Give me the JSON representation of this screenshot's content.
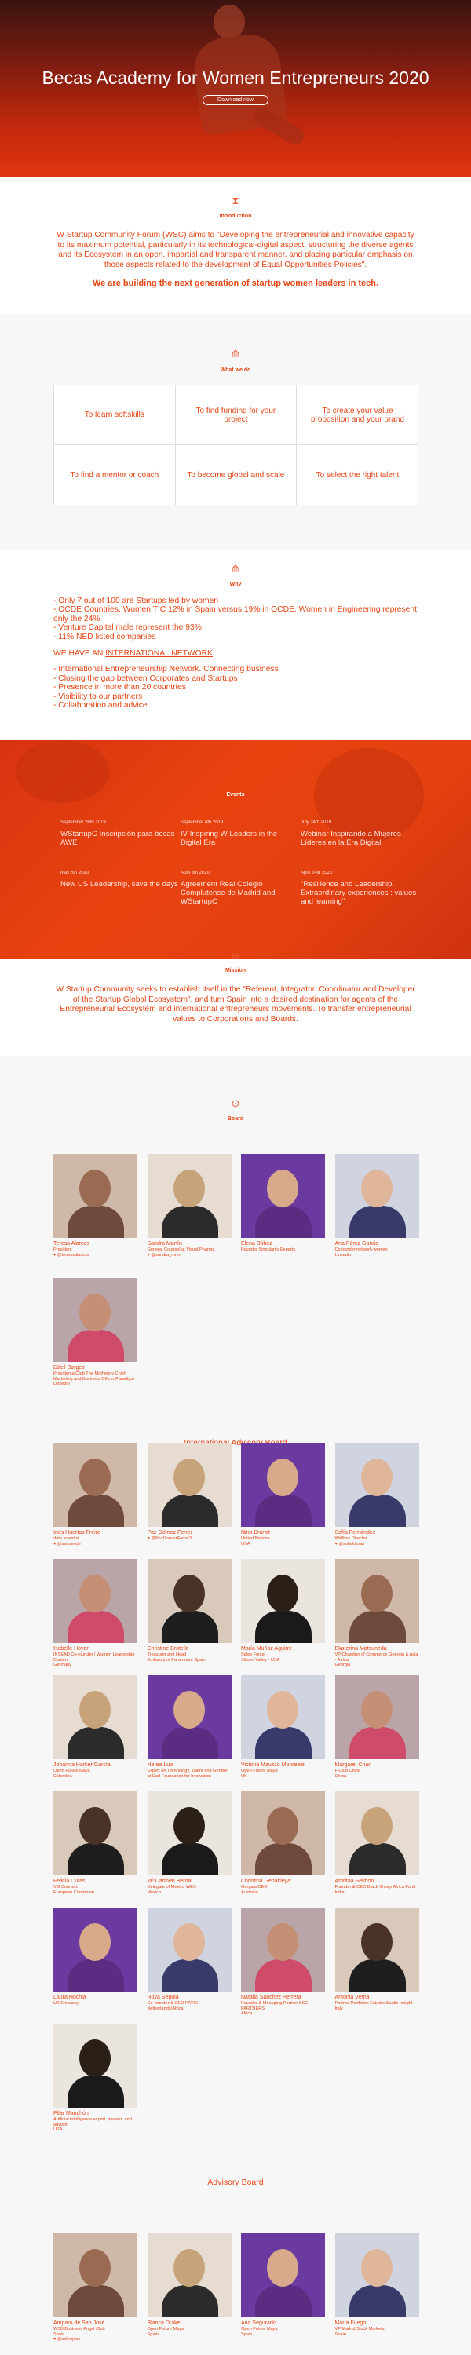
{
  "hero": {
    "title": "Becas Academy for Women Entrepreneurs 2020",
    "button": "Download now"
  },
  "intro": {
    "title": "Introduction",
    "text": "W Startup Community Forum (WSC) aims to \"Developing the entrepreneurial and innovative capacity to its maximum potential, particularly in its technological-digital aspect, structuring the diverse agents and its Ecosystem in an open, impartial and transparent manner, and placing particular emphasis on those aspects related to the development of Equal Opportunities Policies\".",
    "bold": "We are building the next generation of startup women leaders in tech."
  },
  "whatwedo": {
    "title": "What we do",
    "items": [
      "To learn softskills",
      "To find funding for your project",
      "To create your value proposition and your brand",
      "To find a mentor or coach",
      "To become global and scale",
      "To select the right talent"
    ]
  },
  "why": {
    "title": "Why",
    "lines": [
      "- Only 7 out of 100 are Startups led by women",
      "- OCDE Countries. Women TIC 12% in Spain versus 19% in OCDE. Women in Engineering represent only the 24%",
      "- Venture Capital male represent the 93%",
      "- 11% NED listed companies"
    ],
    "network_prefix": "WE HAVE AN ",
    "network_link": "INTERNATIONAL NETWORK",
    "network_lines": [
      "- International Entrepreneurship Network. Connecting business",
      "- Closing the gap between Corporates and Startups",
      "- Presence in more than 20 countries",
      "- Visibility to our partners",
      "- Collaboration and advice"
    ]
  },
  "events": {
    "title": "Events",
    "items": [
      {
        "date": "September 26th 2019",
        "title": "WStartupC Inscripción para becas AWE"
      },
      {
        "date": "September 4th 2019",
        "title": "IV Inspiring W Leaders in the Digital Era"
      },
      {
        "date": "July 24th 2019",
        "title": "Webinar Inspirando a Mujeres Líderes en la Era Digital"
      },
      {
        "date": "May 6th 2020",
        "title": "New US Leadership, save the days"
      },
      {
        "date": "April 8th 2020",
        "title": "Agreement Real Colegio Complutense de Madrid and WStartupC"
      },
      {
        "date": "April 24th 2020",
        "title": "\"Resilience and Leadership. Extraordinary experiences : values and learning\""
      }
    ]
  },
  "mission": {
    "title": "Mission",
    "text": "W Startup Community seeks to establish itself in the \"Referent, Integrator, Coordinator and Developer of the Startup Global Ecosystem\", and turn Spain into a desired destination for agents of the Entrepreneurial Ecosystem and international entrepreneurs movements. To transfer entrepreneurial values to Corporations and Boards."
  },
  "board": {
    "title": "Board",
    "members": [
      {
        "name": "Teresa Alarcos",
        "role": "President\n♥ @tenessalarcos"
      },
      {
        "name": "Sandra Martín",
        "role": "General Counsel at Visual Pharma\n♥ @sandra_mrtn"
      },
      {
        "name": "Elena Bóbez",
        "role": "Founder Singularity Experts"
      },
      {
        "name": "Ana Pérez García",
        "role": "Cofounder network-women\nLinkedin"
      },
      {
        "name": "Dácil Borges",
        "role": "Presidenta Club The Mothers y Chief Marketing and Business Officer Paradigm\nLinkedin"
      }
    ]
  },
  "intl": {
    "title": "International Advisory Board",
    "members": [
      {
        "name": "Inés Huertas Freire",
        "role": "data scientist\n♥ @ssaneride"
      },
      {
        "name": "Paz Gómez Ferrer",
        "role": "♥ @PazGomezFerrer3"
      },
      {
        "name": "Nina Brandt",
        "role": "United Nations\nUSA"
      },
      {
        "name": "Sofía Fernández",
        "role": "Wellbox Director\n♥ @sofiafdman"
      },
      {
        "name": "Isabelle Hoyer",
        "role": "INSEAD Co-founder / Women Leadership Content\nGermany"
      },
      {
        "name": "Christine Brotelle",
        "role": "Treasurer and Head\nEmbassy of Paramount Spain"
      },
      {
        "name": "María Muñoz Aguirre",
        "role": "Sales Force\nSilicon Valley - USA"
      },
      {
        "name": "Ekaterina Matsuneda",
        "role": "VP Chamber of Commerce Georgia & Asia - Africa\nGeorgia"
      },
      {
        "name": "Johanna Harker García",
        "role": "Open Future Maya\nColombia"
      },
      {
        "name": "Nerea Luis",
        "role": "Expert on Technology, Talent and Gender at Carl Foundation for Innovation"
      },
      {
        "name": "Victoria Mauzzo Monreale",
        "role": "Open Future Maya\nUK"
      },
      {
        "name": "Margaret Chan",
        "role": "F Club China\nChina"
      },
      {
        "name": "Felicia Cutas",
        "role": "VM Connect\nEuropean Comission"
      },
      {
        "name": "Mª Carmen Bernal",
        "role": "Delegate of Mexico WES\nMexico"
      },
      {
        "name": "Christina Genakleya",
        "role": "Oorgaia CEO\nAustralia"
      },
      {
        "name": "Amritaa Sekhon",
        "role": "Founder & CEO Black Sheep Africa Fund\nIndia"
      },
      {
        "name": "Laura Hochla",
        "role": "US Embassy"
      },
      {
        "name": "Roya Seguia",
        "role": "Co-founder & CEO PAYCI\nNetherlands/Africa"
      },
      {
        "name": "Natalia Sánchez Herrera",
        "role": "Founder & Managing Partner KSC PARTNERS\nAfrica"
      },
      {
        "name": "Antonia Verna",
        "role": "Partner Portfolios Estudio Studio Insight\nItaly"
      },
      {
        "name": "Pilar Manchón",
        "role": "Artificial intelligence expert, investor and advisor\nUSA"
      }
    ]
  },
  "advisory": {
    "title": "Advisory Board",
    "members": [
      {
        "name": "Amparo de San José",
        "role": "WSB Business Angel Club\nSpain\n♥ @sshrojose"
      },
      {
        "name": "Blanca Drake",
        "role": "Open Future Maya\nSpain"
      },
      {
        "name": "Ana Segurado",
        "role": "Open Future Maya\nSpain"
      },
      {
        "name": "María Fuego",
        "role": "VP Madrid Stock Markets\nSpain"
      }
    ]
  },
  "colors": {
    "accent": "#e54514",
    "accent_light": "#e8623d"
  }
}
